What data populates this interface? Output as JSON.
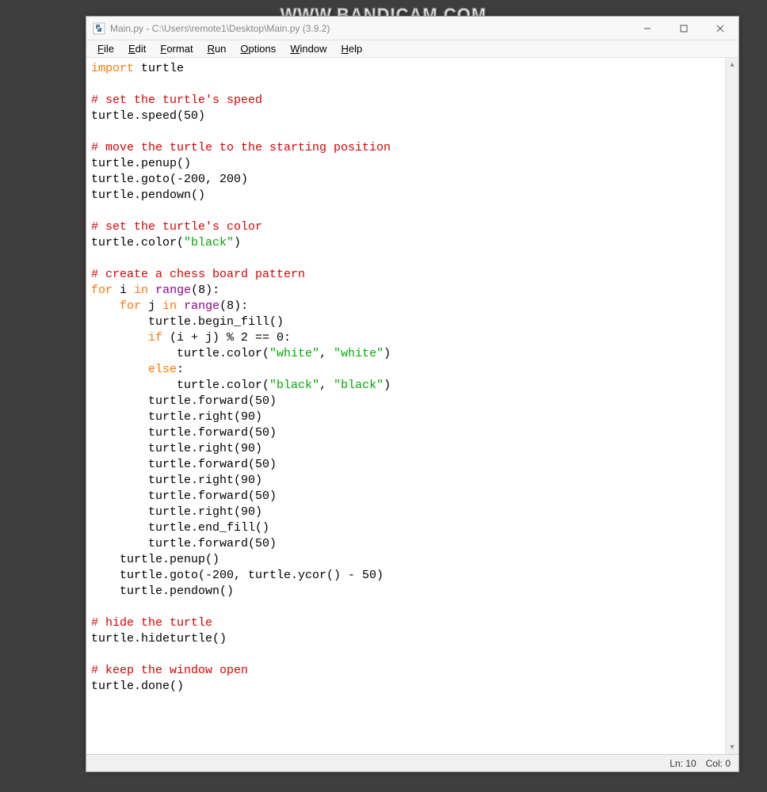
{
  "watermark": "WWW.BANDICAM.COM",
  "window": {
    "title": "Main.py - C:\\Users\\remote1\\Desktop\\Main.py (3.9.2)"
  },
  "menubar": {
    "file": {
      "u": "F",
      "rest": "ile"
    },
    "edit": {
      "u": "E",
      "rest": "dit"
    },
    "format": {
      "u": "F",
      "rest": "ormat"
    },
    "run": {
      "u": "R",
      "rest": "un"
    },
    "options": {
      "u": "O",
      "rest": "ptions"
    },
    "window": {
      "u": "W",
      "rest": "indow"
    },
    "help": {
      "u": "H",
      "rest": "elp"
    }
  },
  "code": {
    "l01a": "import",
    "l01b": " turtle",
    "l02": "",
    "l03": "# set the turtle's speed",
    "l04": "turtle.speed(50)",
    "l05": "",
    "l06": "# move the turtle to the starting position",
    "l07": "turtle.penup()",
    "l08": "turtle.goto(-200, 200)",
    "l09": "turtle.pendown()",
    "l10": "",
    "l11": "# set the turtle's color",
    "l12a": "turtle.color(",
    "l12b": "\"black\"",
    "l12c": ")",
    "l13": "",
    "l14": "# create a chess board pattern",
    "l15a": "for",
    "l15b": " i ",
    "l15c": "in",
    "l15d": " ",
    "l15e": "range",
    "l15f": "(8):",
    "l16a": "    ",
    "l16b": "for",
    "l16c": " j ",
    "l16d": "in",
    "l16e": " ",
    "l16f": "range",
    "l16g": "(8):",
    "l17": "        turtle.begin_fill()",
    "l18a": "        ",
    "l18b": "if",
    "l18c": " (i + j) % 2 == 0:",
    "l19a": "            turtle.color(",
    "l19b": "\"white\"",
    "l19c": ", ",
    "l19d": "\"white\"",
    "l19e": ")",
    "l20a": "        ",
    "l20b": "else",
    "l20c": ":",
    "l21a": "            turtle.color(",
    "l21b": "\"black\"",
    "l21c": ", ",
    "l21d": "\"black\"",
    "l21e": ")",
    "l22": "        turtle.forward(50)",
    "l23": "        turtle.right(90)",
    "l24": "        turtle.forward(50)",
    "l25": "        turtle.right(90)",
    "l26": "        turtle.forward(50)",
    "l27": "        turtle.right(90)",
    "l28": "        turtle.forward(50)",
    "l29": "        turtle.right(90)",
    "l30": "        turtle.end_fill()",
    "l31": "        turtle.forward(50)",
    "l32": "    turtle.penup()",
    "l33": "    turtle.goto(-200, turtle.ycor() - 50)",
    "l34": "    turtle.pendown()",
    "l35": "",
    "l36": "# hide the turtle",
    "l37": "turtle.hideturtle()",
    "l38": "",
    "l39": "# keep the window open",
    "l40": "turtle.done()"
  },
  "status": {
    "ln": "Ln: 10",
    "col": "Col: 0"
  }
}
